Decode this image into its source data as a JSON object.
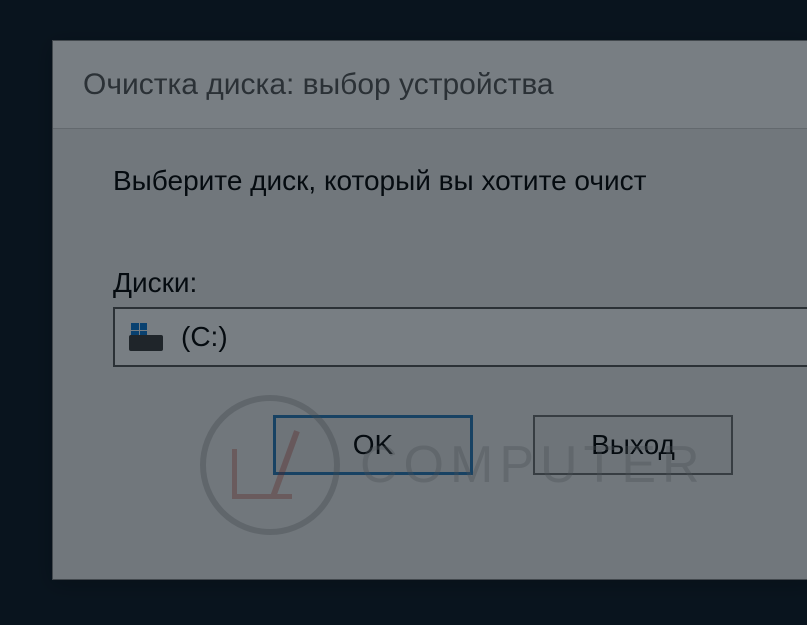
{
  "dialog": {
    "title": "Очистка диска: выбор устройства",
    "instruction": "Выберите диск, который вы хотите очист",
    "drives_label": "Диски:",
    "selected_drive": "(C:)",
    "ok_button": "OK",
    "exit_button": "Выход"
  },
  "watermark": {
    "text": "COMPUTER"
  }
}
